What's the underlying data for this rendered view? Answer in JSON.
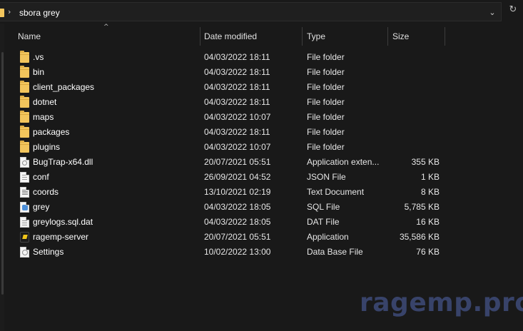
{
  "address_bar": {
    "path_separator": "›",
    "current_folder": "sbora grey",
    "dropdown_icon": "chevron-down-icon",
    "refresh_icon": "refresh-icon"
  },
  "columns": {
    "sort_indicator": "^",
    "name": "Name",
    "date_modified": "Date modified",
    "type": "Type",
    "size": "Size"
  },
  "files": [
    {
      "name": ".vs",
      "date": "04/03/2022 18:11",
      "type": "File folder",
      "size": "",
      "icon": "folder"
    },
    {
      "name": "bin",
      "date": "04/03/2022 18:11",
      "type": "File folder",
      "size": "",
      "icon": "folder"
    },
    {
      "name": "client_packages",
      "date": "04/03/2022 18:11",
      "type": "File folder",
      "size": "",
      "icon": "folder"
    },
    {
      "name": "dotnet",
      "date": "04/03/2022 18:11",
      "type": "File folder",
      "size": "",
      "icon": "folder"
    },
    {
      "name": "maps",
      "date": "04/03/2022 10:07",
      "type": "File folder",
      "size": "",
      "icon": "folder"
    },
    {
      "name": "packages",
      "date": "04/03/2022 18:11",
      "type": "File folder",
      "size": "",
      "icon": "folder"
    },
    {
      "name": "plugins",
      "date": "04/03/2022 10:07",
      "type": "File folder",
      "size": "",
      "icon": "folder"
    },
    {
      "name": "BugTrap-x64.dll",
      "date": "20/07/2021 05:51",
      "type": "Application exten...",
      "size": "355 KB",
      "icon": "dll"
    },
    {
      "name": "conf",
      "date": "26/09/2021 04:52",
      "type": "JSON File",
      "size": "1 KB",
      "icon": "json"
    },
    {
      "name": "coords",
      "date": "13/10/2021 02:19",
      "type": "Text Document",
      "size": "8 KB",
      "icon": "text"
    },
    {
      "name": "grey",
      "date": "04/03/2022 18:05",
      "type": "SQL File",
      "size": "5,785 KB",
      "icon": "sql"
    },
    {
      "name": "greylogs.sql.dat",
      "date": "04/03/2022 18:05",
      "type": "DAT File",
      "size": "16 KB",
      "icon": "dat"
    },
    {
      "name": "ragemp-server",
      "date": "20/07/2021 05:51",
      "type": "Application",
      "size": "35,586 KB",
      "icon": "app"
    },
    {
      "name": "Settings",
      "date": "10/02/2022 13:00",
      "type": "Data Base File",
      "size": "76 KB",
      "icon": "db"
    }
  ],
  "watermark": "ragemp.pro",
  "colors": {
    "background": "#191919",
    "folder": "#f2c55c",
    "watermark": "#3a466f"
  }
}
